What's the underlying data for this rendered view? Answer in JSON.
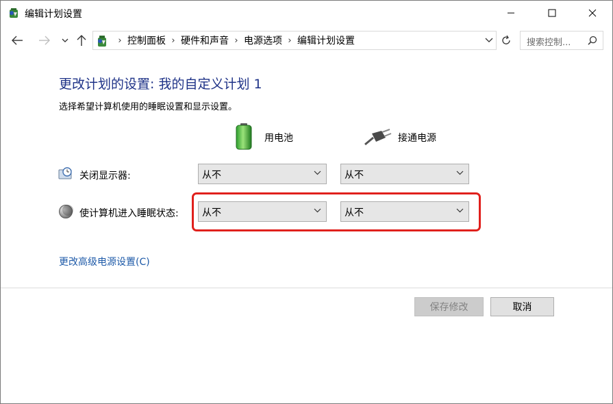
{
  "window": {
    "title": "编辑计划设置"
  },
  "nav": {
    "breadcrumbs": [
      "控制面板",
      "硬件和声音",
      "电源选项",
      "编辑计划设置"
    ],
    "search_placeholder": "搜索控制..."
  },
  "main": {
    "heading": "更改计划的设置: 我的自定义计划 1",
    "subtext": "选择希望计算机使用的睡眠设置和显示设置。",
    "columns": {
      "battery": "用电池",
      "plugged": "接通电源"
    },
    "rows": [
      {
        "label": "关闭显示器:",
        "battery_value": "从不",
        "plugged_value": "从不"
      },
      {
        "label": "使计算机进入睡眠状态:",
        "battery_value": "从不",
        "plugged_value": "从不"
      }
    ],
    "advanced_link": "更改高级电源设置(C)"
  },
  "footer": {
    "save_label": "保存修改",
    "cancel_label": "取消"
  },
  "colors": {
    "heading": "#1e3287",
    "link": "#1e5aa8",
    "highlight": "#e0201c"
  }
}
